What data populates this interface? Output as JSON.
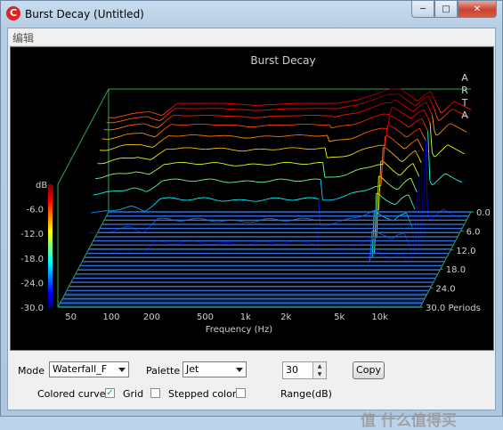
{
  "window": {
    "title": "Burst Decay  (Untitled)",
    "app_icon_glyph": "C",
    "minimize_glyph": "─",
    "maximize_glyph": "□",
    "close_glyph": "✕"
  },
  "menu": {
    "items": [
      "编辑"
    ]
  },
  "chart_data": {
    "type": "waterfall",
    "title": "Burst Decay",
    "brand": [
      "A",
      "R",
      "T",
      "A"
    ],
    "xlabel": "Frequency (Hz)",
    "x_ticks": [
      "50",
      "100",
      "200",
      "500",
      "1k",
      "2k",
      "5k",
      "10k"
    ],
    "x_tick_values": [
      50,
      100,
      200,
      500,
      1000,
      2000,
      5000,
      10000
    ],
    "x_range": [
      40,
      20000
    ],
    "x_scale": "log",
    "y_unit": "dB",
    "y_ticks": [
      "-6.0",
      "-12.0",
      "-18.0",
      "-24.0",
      "-30.0"
    ],
    "y_range": [
      -30,
      0
    ],
    "z_ticks": [
      "0.0",
      "6.0",
      "12.0",
      "18.0",
      "24.0",
      "30.0 Periods"
    ],
    "z_range": [
      0,
      30
    ],
    "palette": "Jet",
    "colors": {
      "grid": "#2aa84a",
      "background": "#000000",
      "text": "#cfcfcf",
      "floor": "#2f6fe0"
    },
    "front_slice": {
      "description_free": true,
      "freq": [
        45,
        60,
        80,
        100,
        130,
        200,
        300,
        500,
        1000,
        2000,
        3000,
        5000,
        6000,
        8000,
        9000,
        10000,
        12000,
        15000,
        20000
      ],
      "level": [
        -7,
        -6,
        -5.5,
        -6.5,
        -3.5,
        -3.5,
        -3.5,
        -4,
        -3.5,
        -3.5,
        -2.5,
        0,
        0,
        -3,
        -1.5,
        -0.5,
        -6,
        -3,
        -5
      ]
    }
  },
  "controls": {
    "mode_label": "Mode",
    "mode_value": "Waterfall_F",
    "palette_label": "Palette",
    "palette_value": "Jet",
    "range_value": "30",
    "range_label": "Range(dB)",
    "copy_label": "Copy",
    "colored_curves_label": "Colored curves",
    "colored_curves_checked": true,
    "grid_label": "Grid",
    "grid_checked": false,
    "stepped_colors_label": "Stepped colors",
    "stepped_colors_checked": false,
    "checkmark_glyph": "✓"
  },
  "watermark": {
    "text": "值 什么值得买"
  }
}
